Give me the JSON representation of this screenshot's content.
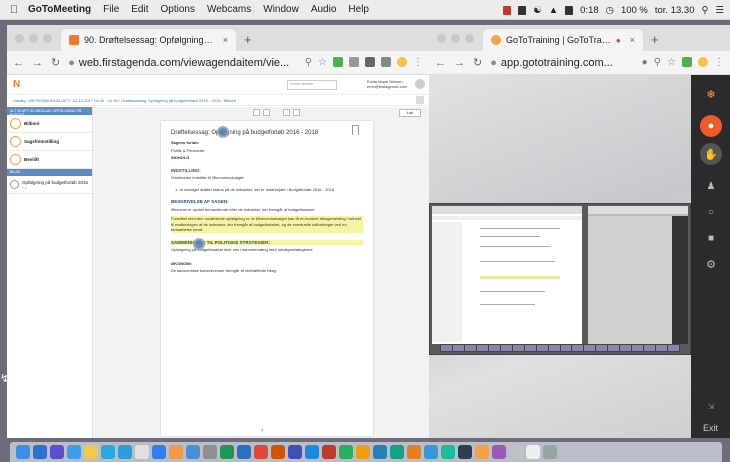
{
  "menubar": {
    "app_name": "GoToMeeting",
    "items": [
      "File",
      "Edit",
      "Options",
      "Webcams",
      "Window",
      "Audio",
      "Help"
    ],
    "battery": "100 %",
    "clock": "tor. 13.30",
    "timer": "0:18"
  },
  "left_browser": {
    "tab_title": "90. Drøftelsessag: Opfølgning på",
    "url": "web.firstagenda.com/viewagendaitem/vie...",
    "fa": {
      "search_placeholder": "Sorter dømte",
      "user_name": "Emila Marie Nielsen",
      "user_email": "emn@firstagenda.com",
      "breadcrumb": "Udvalg  /  ØKONOMIUDVALGET  /  12-10-2017 08.30 - 10.30  /  Drøftelsessag: Opfølgning på budgetforløbt 2016 - 2018  /  Bilboré",
      "side_header": "ALT SKAPT OG ØKOLAN: OPFOLGNING PÅ BUDGET",
      "side_items": [
        "Bilboré",
        "Sagsfremstilling",
        "Bevilift"
      ],
      "side_section": "BILAG",
      "side_attachment": "Opfølgning på budgetforløb 2016 -...",
      "close_button": "Luk"
    },
    "doc": {
      "title": "Drøftelsessag: Opfølgning på budgetforløb 2016 - 2018",
      "sag_label": "Sagens forløb:",
      "sag_value": "Politik & Personale",
      "indhold": "INDHOLD",
      "indstilling": "INDSTILLING:",
      "indstilling_text": "Direktionen indstiller til Økonomiudvalget:",
      "point": "1. at udvalget drøfter status på de indsatser, der er indarbejdet i Budgetforløb 2016 - 2018",
      "beskrivelse": "BESKRIVELSE AF SAGEN:",
      "beskrivelse_text": "Økonomi er opdelt forhandlende efter de indsatser, der fremgår af budgetforløbet.",
      "highlight_text": "Formålet med den nuværende opfølgning er, at Økonomiudvalget kan få en konkret tilbagemelding i forhold til realiseringen af de indsatser, der fremgår af budgetforløbet, og de eventuelle udfordringer ved en fortsættelse heraf.",
      "sammenhaeng": "SAMMENHÆNG TIL POLITISKE STRATEGIER:",
      "sammenhaeng_text": "Opfølgning på budgetforløbet sker ses i sammenhæng med udvalgsstrategierne",
      "okonomi": "ØKONOMI:",
      "okonomi_text": "De økonomiske konsekvenser fremgår af vedhæftede bilag.",
      "page_number": "1"
    }
  },
  "right_browser": {
    "tab_title": "GoToTraining | GoToTraining",
    "url": "app.gototraining.com...",
    "exit_label": "Exit"
  },
  "colors": {
    "accent_orange": "#f07a2a",
    "gt_rail": "#2b2b2e",
    "fa_blue": "#5b8cc4"
  }
}
